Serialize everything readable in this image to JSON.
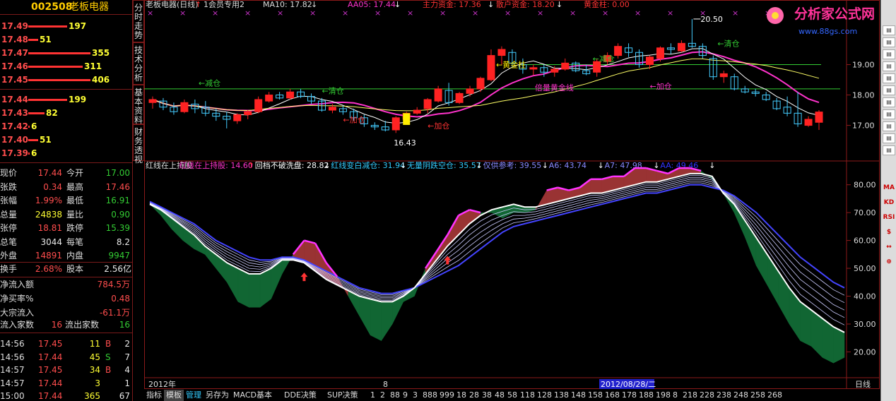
{
  "stock": {
    "code": "002508",
    "name": "老板电器"
  },
  "order_book": {
    "asks": [
      {
        "price": "17.49",
        "vol": "197",
        "bar": 0.63
      },
      {
        "price": "17.48",
        "vol": "51",
        "bar": 0.16
      },
      {
        "price": "17.47",
        "vol": "355",
        "bar": 1.0
      },
      {
        "price": "17.46",
        "vol": "311",
        "bar": 0.88
      },
      {
        "price": "17.45",
        "vol": "406",
        "bar": 1.0
      }
    ],
    "bids": [
      {
        "price": "17.44",
        "vol": "199",
        "bar": 0.63
      },
      {
        "price": "17.43",
        "vol": "82",
        "bar": 0.26
      },
      {
        "price": "17.42",
        "vol": "6",
        "bar": 0.02
      },
      {
        "price": "17.40",
        "vol": "51",
        "bar": 0.16
      },
      {
        "price": "17.39",
        "vol": "6",
        "bar": 0.02
      }
    ]
  },
  "quote": [
    {
      "l1": "现价",
      "v1": "17.44",
      "c1": "red",
      "l2": "今开",
      "v2": "17.00",
      "c2": "grn"
    },
    {
      "l1": "张跌",
      "v1": "0.34",
      "c1": "red",
      "l2": "最高",
      "v2": "17.46",
      "c2": "red"
    },
    {
      "l1": "张幅",
      "v1": "1.99%",
      "c1": "red",
      "l2": "最低",
      "v2": "16.91",
      "c2": "grn"
    },
    {
      "l1": "总量",
      "v1": "24838",
      "c1": "yel",
      "l2": "量比",
      "v2": "0.90",
      "c2": "grn"
    },
    {
      "l1": "张停",
      "v1": "18.81",
      "c1": "red",
      "l2": "跌停",
      "v2": "15.39",
      "c2": "grn"
    },
    {
      "l1": "总笔",
      "v1": "3044",
      "c1": "wht",
      "l2": "每笔",
      "v2": "8.2",
      "c2": "wht"
    },
    {
      "l1": "外盘",
      "v1": "14891",
      "c1": "red",
      "l2": "内盘",
      "v2": "9947",
      "c2": "grn"
    }
  ],
  "extra": {
    "turnover_label": "换手",
    "turnover": "2.68%",
    "share_label": "股本",
    "share": "2.56亿",
    "net_in_label": "净流入额",
    "net_in": "784.5万",
    "net_buy_label": "净买率%",
    "net_buy": "0.48",
    "block_label": "大宗流入",
    "block": "-61.1万",
    "in_count_label": "流入家数",
    "in_count": "16",
    "out_count_label": "流出家数",
    "out_count": "16"
  },
  "ticks": [
    {
      "time": "14:56",
      "price": "17.45",
      "vol": "11",
      "bs": "B",
      "n": "2"
    },
    {
      "time": "14:56",
      "price": "17.44",
      "vol": "45",
      "bs": "S",
      "n": "7"
    },
    {
      "time": "14:57",
      "price": "17.45",
      "vol": "34",
      "bs": "B",
      "n": "4"
    },
    {
      "time": "14:57",
      "price": "17.44",
      "vol": "3",
      "bs": "",
      "n": "1"
    },
    {
      "time": "15:00",
      "price": "17.44",
      "vol": "365",
      "bs": "",
      "n": "67"
    }
  ],
  "vtabs": [
    "分时走势",
    "技术分析",
    "基本资料",
    "财务透视"
  ],
  "top_legend": {
    "title": "老板电器(日线)",
    "arrow": "↑",
    "member": "1会员专用2",
    "ma10": "MA10: 17.82",
    "ma10_arrow": "↓",
    "aa05": "AA05: 17.44",
    "aa05_arrow": "↓",
    "main_fund": "主力资金: 17.36",
    "main_fund_arrow": "↓",
    "retail": "散户资金: 18.20",
    "retail_arrow": "↓",
    "gold": "黄金柱: 0.00"
  },
  "lower_legend": [
    {
      "t": "红线在上持股",
      "c": "#ddd"
    },
    {
      "t": "红线在上持股: 14.60",
      "c": "#ff33cc"
    },
    {
      "t": "↑",
      "c": "#ff3333"
    },
    {
      "t": "回档不破洗盘: 28.82",
      "c": "#fff"
    },
    {
      "t": "↓",
      "c": "#fff"
    },
    {
      "t": "红线变白减仓: 31.94",
      "c": "#33ccff"
    },
    {
      "t": "↓",
      "c": "#fff"
    },
    {
      "t": "无量阴跌空仓: 35.57",
      "c": "#33ccff"
    },
    {
      "t": "↓",
      "c": "#fff"
    },
    {
      "t": "仅供参考: 39.55",
      "c": "#8888ff"
    },
    {
      "t": "↓",
      "c": "#fff"
    },
    {
      "t": "A6: 43.74",
      "c": "#8888ff"
    },
    {
      "t": "↓",
      "c": "#fff"
    },
    {
      "t": "A7: 47.98",
      "c": "#8888ff"
    },
    {
      "t": "↓",
      "c": "#fff"
    },
    {
      "t": "AA: 49.46",
      "c": "#3333ff"
    },
    {
      "t": "↓",
      "c": "#fff"
    }
  ],
  "annotations": {
    "high": "20.50",
    "low": "16.43",
    "reduce": "←减仓",
    "clear": "←清仓",
    "add": "←加仓",
    "gold_col": "←黄金柱",
    "gold_line": "倍量黄金线"
  },
  "watermark": {
    "text": "分析家公式网",
    "url": "www.88gs.com"
  },
  "upper_axis": [
    "19.00",
    "18.00",
    "17.00"
  ],
  "lower_axis": [
    "80.00",
    "70.00",
    "60.00",
    "50.00",
    "40.00",
    "30.00",
    "20.00"
  ],
  "date_axis": {
    "year": "2012年",
    "marker": "8",
    "highlight": "2012/08/28/二",
    "period": "日线"
  },
  "bottom_tabs": [
    "指标",
    "模板",
    "管理",
    "另存为",
    "MACD基本",
    "DDE决策",
    "SUP决策",
    "1",
    "2",
    "88",
    "9",
    "3",
    "888",
    "999",
    "18",
    "28",
    "38",
    "48",
    "58",
    "118",
    "128",
    "138",
    "148",
    "158",
    "168",
    "178",
    "188",
    "198",
    "8",
    "218",
    "228",
    "238",
    "248",
    "258",
    "268"
  ],
  "right_icons": [
    "MA",
    "KD",
    "RSI",
    "$",
    "↔",
    "⊕"
  ],
  "chart_data": {
    "type": "candlestick",
    "upper": {
      "ylim": [
        16.2,
        20.8
      ],
      "candles": [
        [
          17.75,
          17.95,
          17.55,
          17.85
        ],
        [
          17.8,
          17.9,
          17.5,
          17.6
        ],
        [
          17.6,
          17.75,
          17.35,
          17.45
        ],
        [
          17.45,
          17.85,
          17.4,
          17.75
        ],
        [
          17.7,
          17.85,
          17.4,
          17.55
        ],
        [
          17.6,
          17.8,
          17.3,
          17.4
        ],
        [
          17.4,
          17.55,
          17.15,
          17.3
        ],
        [
          17.3,
          17.45,
          16.9,
          17.2
        ],
        [
          17.15,
          17.4,
          17.05,
          17.35
        ],
        [
          17.35,
          17.5,
          17.2,
          17.45
        ],
        [
          17.45,
          17.95,
          17.4,
          17.85
        ],
        [
          17.8,
          18.1,
          17.75,
          18.0
        ],
        [
          18.0,
          18.1,
          17.85,
          17.9
        ],
        [
          17.9,
          18.2,
          17.85,
          18.1
        ],
        [
          18.1,
          18.2,
          17.9,
          17.95
        ],
        [
          17.95,
          18.05,
          17.7,
          17.8
        ],
        [
          17.8,
          17.9,
          17.45,
          17.5
        ],
        [
          17.5,
          17.7,
          17.4,
          17.6
        ],
        [
          17.55,
          17.65,
          17.35,
          17.45
        ],
        [
          17.45,
          17.55,
          17.15,
          17.25
        ],
        [
          17.25,
          17.35,
          16.95,
          17.05
        ],
        [
          17.0,
          17.1,
          16.85,
          16.95
        ],
        [
          16.95,
          17.15,
          16.8,
          16.85
        ],
        [
          16.85,
          17.3,
          16.75,
          17.25
        ],
        [
          17.2,
          17.45,
          17.15,
          17.4
        ],
        [
          17.4,
          17.6,
          17.35,
          17.5
        ],
        [
          17.55,
          17.9,
          17.4,
          17.85
        ],
        [
          17.8,
          18.3,
          17.75,
          18.2
        ],
        [
          18.15,
          18.4,
          17.65,
          17.75
        ],
        [
          17.75,
          18.1,
          17.7,
          18.05
        ],
        [
          18.05,
          18.3,
          17.95,
          18.2
        ],
        [
          18.2,
          18.6,
          18.1,
          18.55
        ],
        [
          18.5,
          19.5,
          18.45,
          19.3
        ],
        [
          19.3,
          19.6,
          19.0,
          19.5
        ],
        [
          19.4,
          19.5,
          18.9,
          19.05
        ],
        [
          19.0,
          19.2,
          18.7,
          18.85
        ],
        [
          18.85,
          19.0,
          18.65,
          18.9
        ],
        [
          18.9,
          19.0,
          18.6,
          18.75
        ],
        [
          18.75,
          18.95,
          18.6,
          18.85
        ],
        [
          18.85,
          19.2,
          18.8,
          19.05
        ],
        [
          19.05,
          19.1,
          18.75,
          18.8
        ],
        [
          18.8,
          19.0,
          18.65,
          18.7
        ],
        [
          18.75,
          19.2,
          18.6,
          19.1
        ],
        [
          19.1,
          19.4,
          19.0,
          19.3
        ],
        [
          19.3,
          19.7,
          19.2,
          19.6
        ],
        [
          19.55,
          19.7,
          19.25,
          19.4
        ],
        [
          19.4,
          19.5,
          18.9,
          19.0
        ],
        [
          19.0,
          19.3,
          18.85,
          19.25
        ],
        [
          19.2,
          19.6,
          19.1,
          19.55
        ],
        [
          19.55,
          19.7,
          19.35,
          19.5
        ],
        [
          19.45,
          19.8,
          19.4,
          19.7
        ],
        [
          19.7,
          20.5,
          19.55,
          19.6
        ],
        [
          19.6,
          19.7,
          19.2,
          19.3
        ],
        [
          19.2,
          19.3,
          18.5,
          18.6
        ],
        [
          18.6,
          18.8,
          18.4,
          18.7
        ],
        [
          18.6,
          18.7,
          18.15,
          18.2
        ],
        [
          18.2,
          18.3,
          18.05,
          18.1
        ],
        [
          18.1,
          18.2,
          17.95,
          18.05
        ],
        [
          18.0,
          18.1,
          17.8,
          17.85
        ],
        [
          17.8,
          17.9,
          17.5,
          17.55
        ],
        [
          17.6,
          17.95,
          17.3,
          17.4
        ],
        [
          17.4,
          18.1,
          16.95,
          17.05
        ],
        [
          17.0,
          17.3,
          16.95,
          17.2
        ],
        [
          17.1,
          17.5,
          16.85,
          17.44
        ]
      ]
    },
    "lower": {
      "ylim": [
        12,
        86
      ],
      "x": [
        0,
        1,
        2,
        3,
        4,
        5,
        6,
        7,
        8,
        9,
        10,
        11,
        12,
        13,
        14,
        15,
        16,
        17,
        18,
        19,
        20,
        21,
        22,
        23,
        24,
        25,
        26,
        27,
        28,
        29,
        30,
        31,
        32,
        33,
        34,
        35,
        36,
        37,
        38,
        39,
        40,
        41,
        42,
        43,
        44,
        45,
        46,
        47,
        48,
        49,
        50,
        51,
        52,
        53,
        54,
        55,
        56,
        57,
        58,
        59,
        60,
        61,
        62,
        63
      ],
      "white": [
        73,
        71,
        68,
        65,
        62,
        58,
        55,
        52,
        50,
        48,
        48,
        50,
        53,
        53,
        52,
        49,
        46,
        44,
        42,
        40,
        39,
        38,
        38,
        40,
        43,
        48,
        53,
        58,
        62,
        66,
        69,
        71,
        72,
        73,
        72,
        72,
        73,
        74,
        75,
        76,
        77,
        77,
        78,
        79,
        80,
        81,
        81,
        82,
        83,
        84,
        84,
        83,
        77,
        73,
        67,
        61,
        55,
        49,
        43,
        38,
        35,
        32,
        29,
        27
      ],
      "red": [
        73,
        69,
        64,
        60,
        57,
        55,
        50,
        45,
        38,
        36,
        36,
        39,
        48,
        55,
        60,
        59,
        52,
        47,
        40,
        33,
        26,
        24,
        30,
        38,
        40,
        50,
        56,
        62,
        69,
        71,
        70,
        70,
        68,
        70,
        70,
        71,
        78,
        79,
        78,
        79,
        82,
        82,
        83,
        83,
        86,
        86,
        85,
        84,
        86,
        86,
        85,
        82,
        77,
        70,
        61,
        51,
        44,
        37,
        30,
        24,
        22,
        18,
        16,
        18
      ],
      "ema": [
        74,
        72,
        70,
        68,
        66,
        63,
        60,
        58,
        56,
        54,
        53,
        53,
        54,
        54,
        53,
        51,
        49,
        47,
        45,
        43,
        42,
        41,
        41,
        42,
        43,
        45,
        47,
        49,
        51,
        54,
        57,
        60,
        63,
        65,
        66,
        67,
        68,
        69,
        70,
        71,
        72,
        73,
        74,
        75,
        76,
        77,
        77,
        78,
        79,
        80,
        80,
        79,
        78,
        76,
        73,
        70,
        66,
        62,
        58,
        54,
        51,
        48,
        45,
        43
      ],
      "signals_up": [
        14,
        27
      ]
    }
  }
}
